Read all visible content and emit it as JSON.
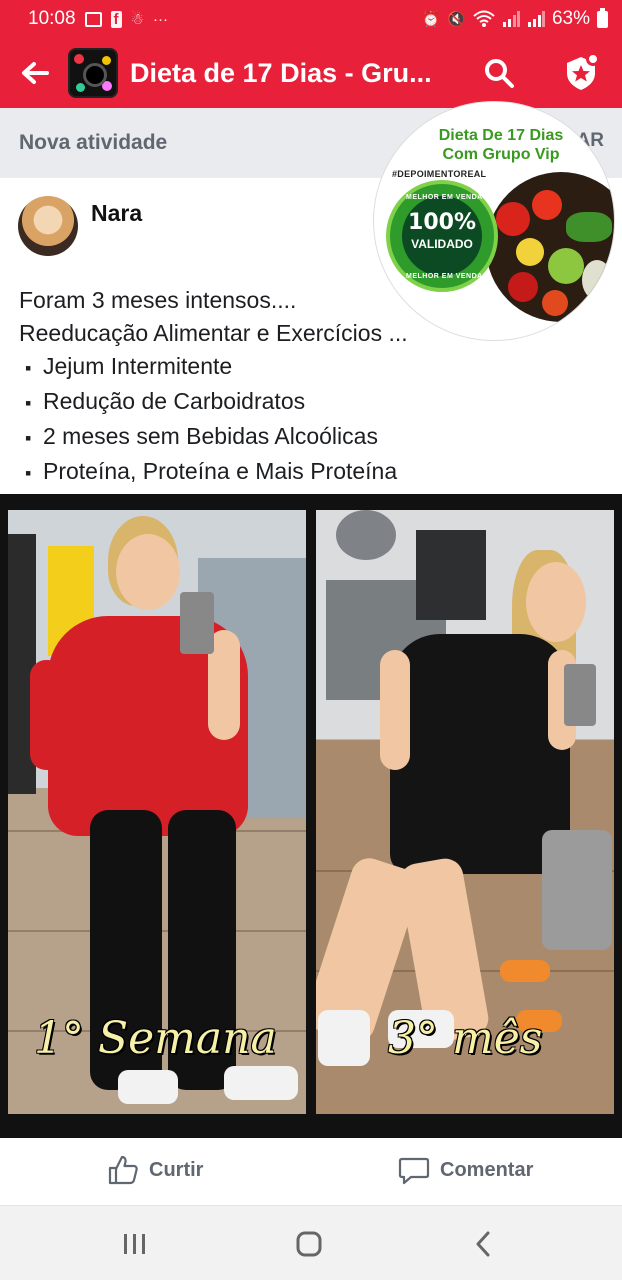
{
  "status_bar": {
    "time": "10:08",
    "dots": "···",
    "battery": "63%",
    "icons": [
      "gallery-icon",
      "facebook-icon",
      "notification-icon",
      "alarm-icon",
      "mute-icon",
      "wifi-icon",
      "signal-icon",
      "signal-icon",
      "battery-icon"
    ]
  },
  "header": {
    "title": "Dieta de 17 Dias - Gru...",
    "back_icon": "back-arrow-icon",
    "search_icon": "search-icon",
    "badge_icon": "admin-badge-icon"
  },
  "activity": {
    "label": "Nova atividade",
    "action": "CAR"
  },
  "post": {
    "author": "Nara",
    "lines": [
      "Foram 3 meses intensos....",
      "Reeducação Alimentar e Exercícios ..."
    ],
    "list": [
      "Jejum Intermitente",
      "Redução de Carboidratos",
      "2 meses sem Bebidas Alcoólicas",
      "Proteína, Proteína e Mais Proteína"
    ],
    "photo": {
      "left_caption": "1° Semana",
      "right_caption": "3° mês"
    }
  },
  "promo": {
    "title_line1": "Dieta De 17 Dias",
    "title_line2": "Com Grupo Vip",
    "hashtag": "#DEPOIMENTOREAL",
    "seal_top": "MELHOR EM VENDAS",
    "seal_percent": "100%",
    "seal_word": "VALIDADO",
    "seal_bottom": "MELHOR EM VENDAS",
    "accent": "#3a9a1f"
  },
  "actions": {
    "like": "Curtir",
    "comment": "Comentar"
  },
  "nav": {
    "icons": [
      "recent-apps-icon",
      "home-icon",
      "back-icon"
    ]
  },
  "colors": {
    "brand_red": "#e8203a",
    "strip_gray": "#e9ebee"
  }
}
